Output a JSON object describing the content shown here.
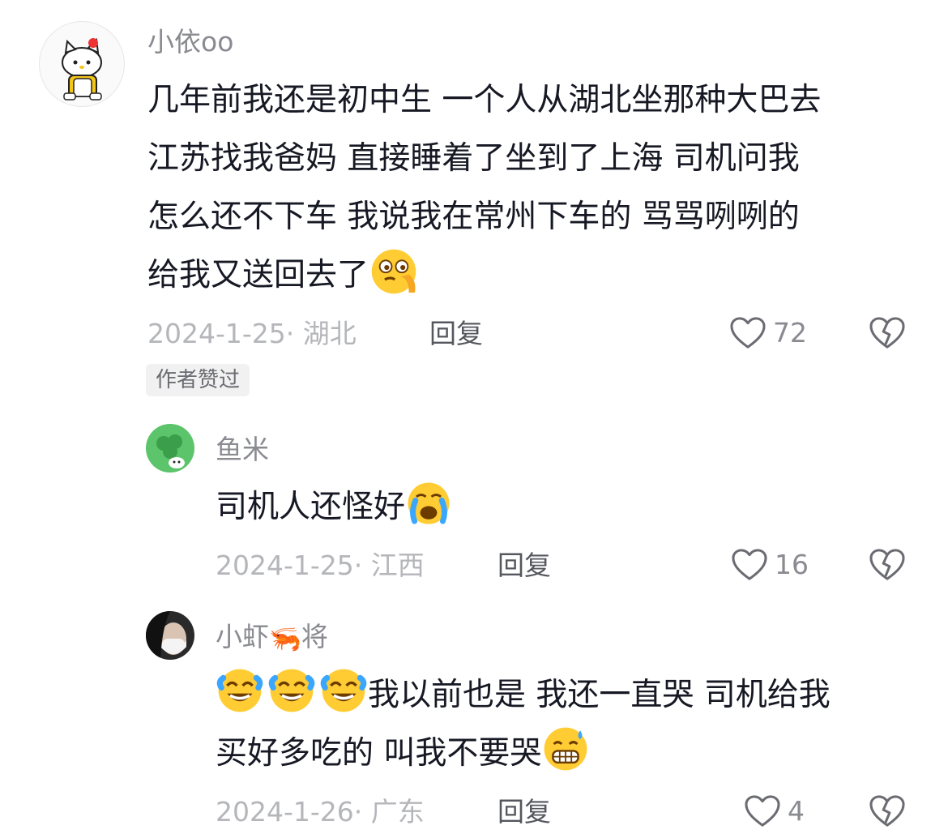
{
  "comments": [
    {
      "username": "小依oo",
      "lines": [
        "几年前我还是初中生 一个人从湖北坐那种大巴去",
        "江苏找我爸妈 直接睡着了坐到了上海 司机问我",
        "怎么还不下车 我说我在常州下车的 骂骂咧咧的",
        "给我又送回去了"
      ],
      "trailing_emoji": "peeking-eye-emoji",
      "date_location": "2024-1-25· 湖北",
      "reply_label": "回复",
      "like_count": "72",
      "author_badge": "作者赞过"
    }
  ],
  "replies": [
    {
      "username": "鱼米",
      "lines": [
        "司机人还怪好"
      ],
      "trailing_emoji": "crying-emoji",
      "date_location": "2024-1-25· 江西",
      "reply_label": "回复",
      "like_count": "16"
    },
    {
      "username_part1": "小虾",
      "username_emoji": "🦐",
      "username_part2": "将",
      "line1_text": "我以前也是 我还一直哭 司机给我",
      "line2_text": "买好多吃的 叫我不要哭",
      "date_location": "2024-1-26· 广东",
      "reply_label": "回复",
      "like_count": "4"
    }
  ],
  "colors": {
    "primary_text": "#161823",
    "secondary_text": "#8a8b91",
    "date_text": "#b5b6ba",
    "reply_text": "#55575e",
    "badge_bg": "#f1f1f2"
  }
}
